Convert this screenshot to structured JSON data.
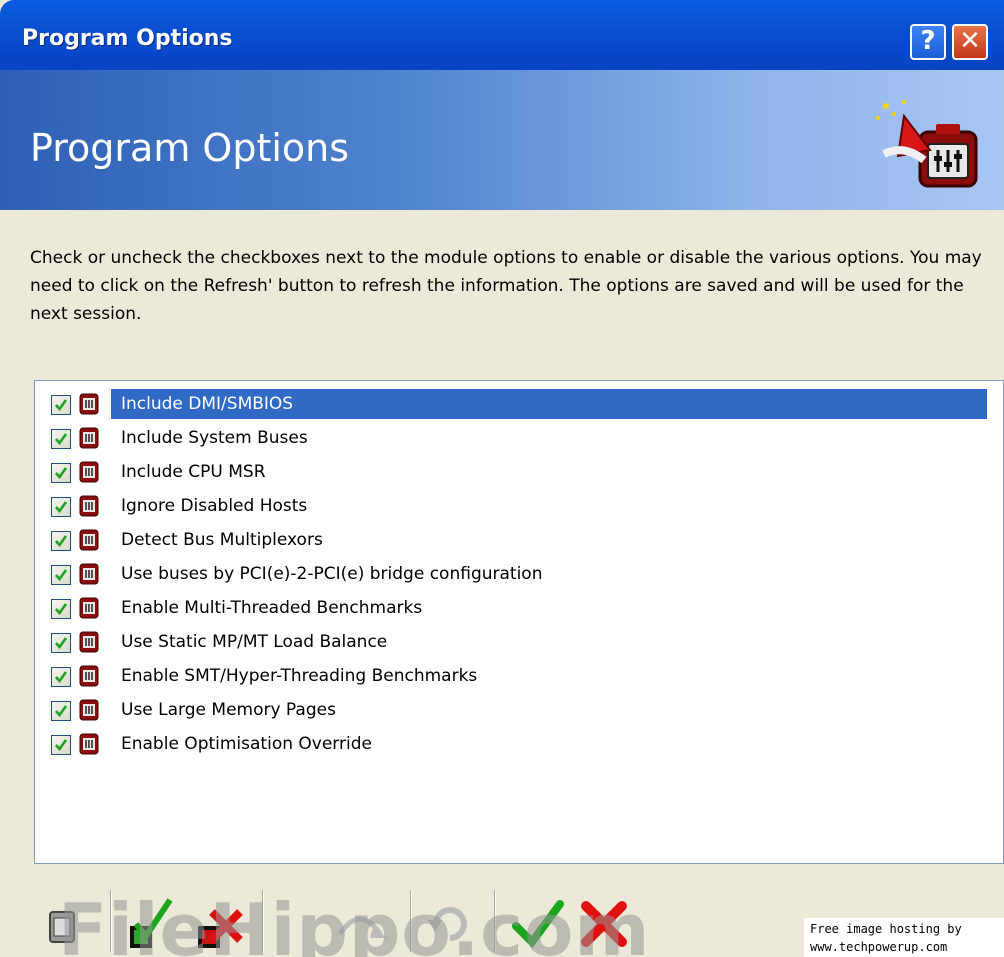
{
  "window": {
    "title": "Program Options",
    "help_label": "?",
    "close_label": "✕"
  },
  "banner": {
    "title": "Program Options",
    "icon": "program-options-icon"
  },
  "description": "Check or uncheck the checkboxes next to the module options to enable or disable the various options. You may need to click on the Refresh' button to refresh the information. The options are saved and will be used for the next session.",
  "options": [
    {
      "label": "Include DMI/SMBIOS",
      "checked": true,
      "selected": true
    },
    {
      "label": "Include System Buses",
      "checked": true,
      "selected": false
    },
    {
      "label": "Include CPU MSR",
      "checked": true,
      "selected": false
    },
    {
      "label": "Ignore Disabled Hosts",
      "checked": true,
      "selected": false
    },
    {
      "label": "Detect Bus Multiplexors",
      "checked": true,
      "selected": false
    },
    {
      "label": "Use buses by PCI(e)-2-PCI(e) bridge configuration",
      "checked": true,
      "selected": false
    },
    {
      "label": "Enable Multi-Threaded Benchmarks",
      "checked": true,
      "selected": false
    },
    {
      "label": "Use Static MP/MT Load Balance",
      "checked": true,
      "selected": false
    },
    {
      "label": "Enable SMT/Hyper-Threading Benchmarks",
      "checked": true,
      "selected": false
    },
    {
      "label": "Use Large Memory Pages",
      "checked": true,
      "selected": false
    },
    {
      "label": "Enable Optimisation Override",
      "checked": true,
      "selected": false
    }
  ],
  "toolbar": {
    "tools": [
      "module-icon",
      "check-all-icon",
      "uncheck-all-icon",
      "undo-icon",
      "refresh-icon",
      "ok-icon",
      "cancel-icon"
    ]
  },
  "watermark": "FileHippo.com",
  "hosting": {
    "line1": "Free image hosting by",
    "line2": "www.techpowerup.com"
  },
  "colors": {
    "selection": "#316ac5",
    "titlebar": "#0a4fd0",
    "ok": "#1aa51a",
    "cancel": "#e01010"
  }
}
